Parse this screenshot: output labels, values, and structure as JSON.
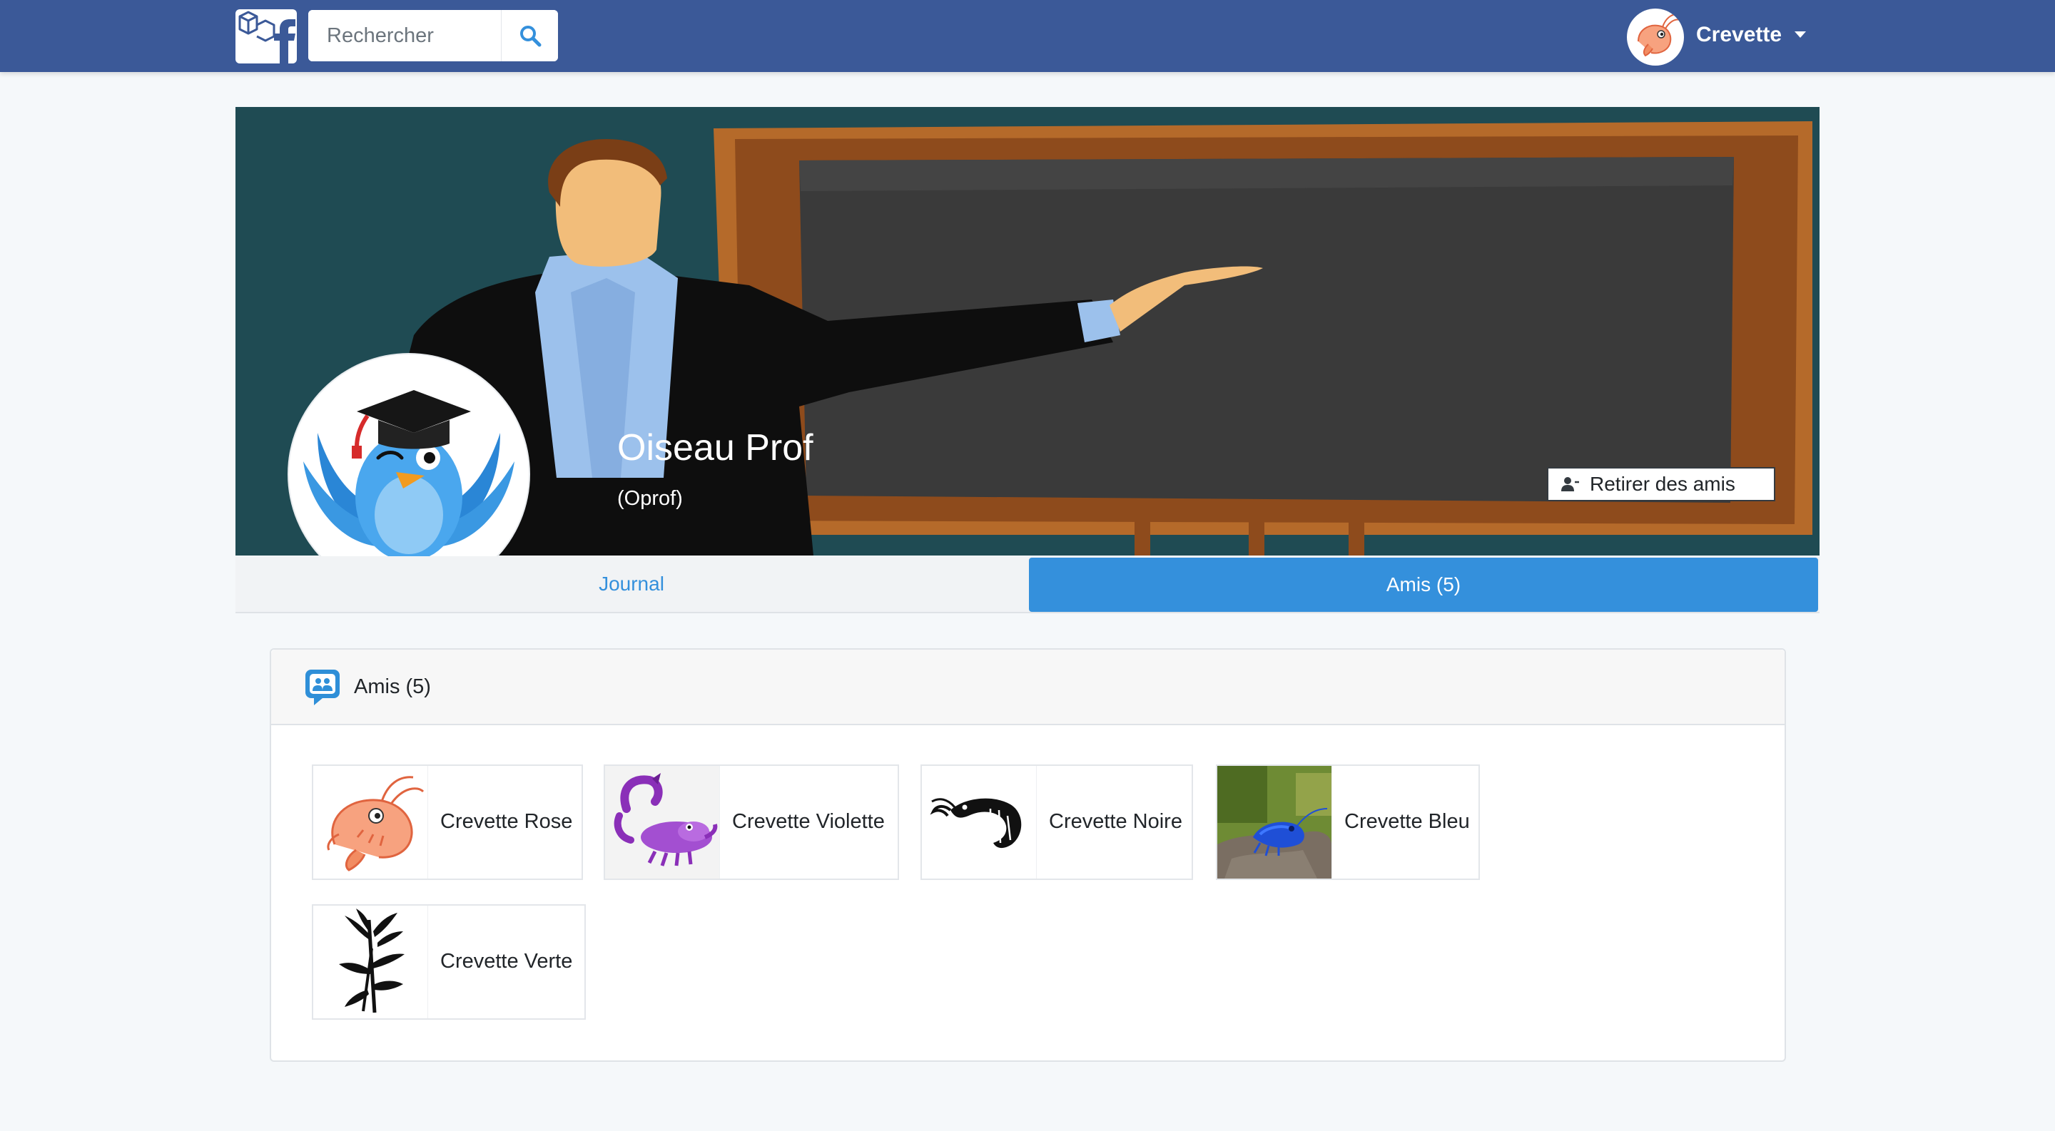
{
  "navbar": {
    "brand_icon": "laravel-facebook-logo",
    "search": {
      "placeholder": "Rechercher",
      "value": ""
    },
    "user": {
      "name": "Crevette"
    }
  },
  "profile": {
    "name": "Oiseau Prof",
    "handle": "(Oprof)",
    "unfriend_label": "Retirer des amis"
  },
  "tabs": [
    {
      "label": "Journal",
      "active": false
    },
    {
      "label": "Amis (5)",
      "active": true
    }
  ],
  "friends_card": {
    "title": "Amis (5)",
    "friends": [
      {
        "name": "Crevette Rose",
        "icon": "pink-shrimp-icon"
      },
      {
        "name": "Crevette Violette",
        "icon": "purple-scorpion-icon"
      },
      {
        "name": "Crevette Noire",
        "icon": "black-shrimp-icon"
      },
      {
        "name": "Crevette Bleu",
        "icon": "blue-shrimp-photo"
      },
      {
        "name": "Crevette Verte",
        "icon": "bamboo-icon"
      }
    ]
  },
  "colors": {
    "navbar": "#3b5998",
    "accent": "#3490dc",
    "page_background": "#f5f8fa"
  }
}
